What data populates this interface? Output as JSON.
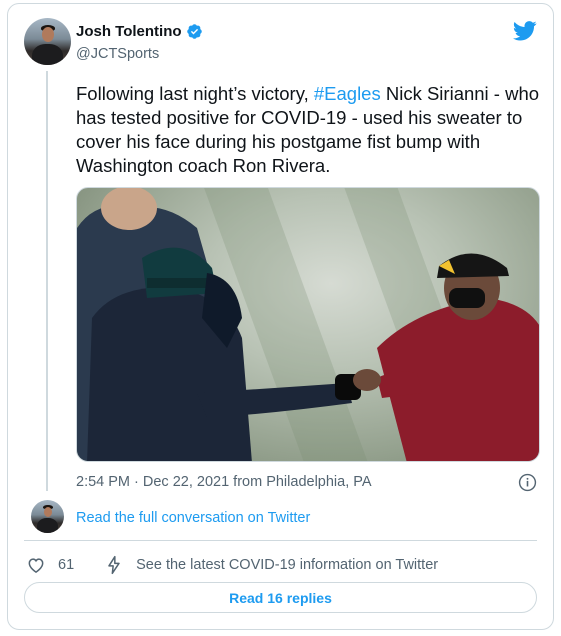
{
  "author": {
    "name": "Josh Tolentino",
    "handle": "@JCTSports",
    "verified": true,
    "avatar_icon": "user-avatar"
  },
  "tweet": {
    "text_before": "Following last night’s victory, ",
    "hashtag": "#Eagles",
    "text_after": " Nick Sirianni - who has tested positive for COVID-19 - used his sweater to cover his face during his postgame fist bump with Washington coach Ron Rivera.",
    "timestamp": "2:54 PM · Dec 22, 2021 from Philadelphia, PA"
  },
  "media": {
    "kind": "photo",
    "description_icon": "photo"
  },
  "links": {
    "read_conversation": "Read the full conversation on Twitter"
  },
  "actions": {
    "like_count": "61",
    "covid_info": "See the latest COVID-19 information on Twitter",
    "read_replies": "Read 16 replies"
  },
  "colors": {
    "accent": "#1d9bf0",
    "text": "#0f1419",
    "muted": "#536471",
    "border": "#cfd9de"
  }
}
